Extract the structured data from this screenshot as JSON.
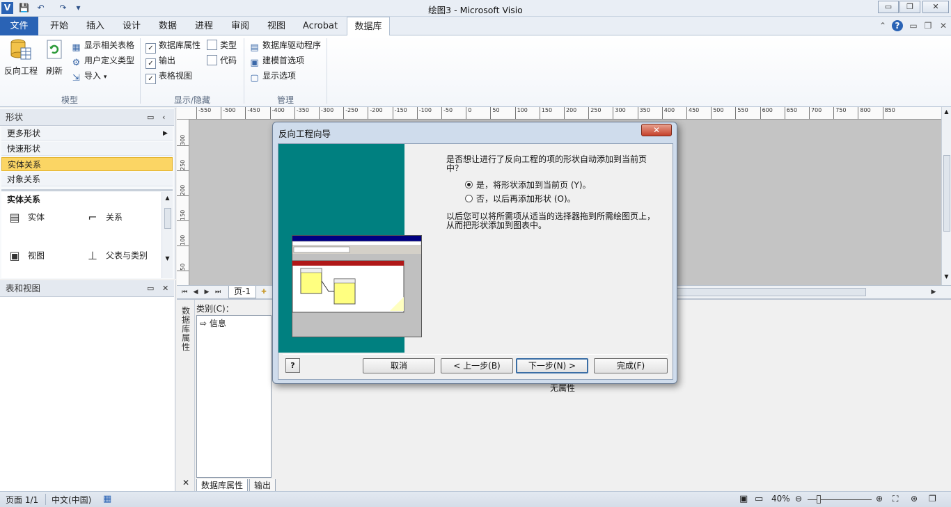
{
  "window": {
    "title": "绘图3  -  Microsoft Visio",
    "minimize": "▭",
    "restore": "❐",
    "close": "✕"
  },
  "ribbon_tabs": [
    "文件",
    "开始",
    "插入",
    "设计",
    "数据",
    "进程",
    "审阅",
    "视图",
    "Acrobat",
    "数据库"
  ],
  "ribbon": {
    "model": {
      "reverse_engineer": "反向工程",
      "refresh": "刷新",
      "show_related_tables": "显示相关表格",
      "user_defined_types": "用户定义类型",
      "import": "导入",
      "group_label": "模型"
    },
    "show_hide": {
      "db_properties": "数据库属性",
      "output": "输出",
      "table_view": "表格视图",
      "types": "类型",
      "code": "代码",
      "group_label": "显示/隐藏"
    },
    "manage": {
      "db_drivers": "数据库驱动程序",
      "modeling_prefs": "建模首选项",
      "display_options": "显示选项",
      "group_label": "管理"
    }
  },
  "shapes_panel": {
    "title": "形状",
    "items": [
      "更多形状",
      "快速形状",
      "实体关系",
      "对象关系"
    ],
    "section_title": "实体关系",
    "stencils": [
      "实体",
      "关系",
      "视图",
      "父表与类别"
    ]
  },
  "tables_panel": {
    "title": "表和视图"
  },
  "ruler_labels": [
    "-550",
    "-500",
    "-450",
    "-400",
    "-350",
    "-300",
    "-250",
    "-200",
    "-150",
    "-100",
    "-50",
    "0",
    "50",
    "100",
    "150",
    "200",
    "250",
    "300",
    "350",
    "400",
    "450",
    "500",
    "550",
    "600",
    "650",
    "700",
    "750",
    "800",
    "850"
  ],
  "vruler_labels": [
    "300",
    "250",
    "200",
    "150",
    "100",
    "50"
  ],
  "page_tab": "页-1",
  "properties": {
    "side_title": "数据库属性",
    "category_label": "类别(C)：",
    "category_item": "信息",
    "no_props": "无属性",
    "bottom_tabs": [
      "数据库属性",
      "输出"
    ]
  },
  "status": {
    "page": "页面 1/1",
    "language": "中文(中国)",
    "zoom": "40%"
  },
  "dialog": {
    "title": "反向工程向导",
    "question": "是否想让进行了反向工程的项的形状自动添加到当前页中？",
    "option_yes": "是，将形状添加到当前页 (Y)。",
    "option_no": "否，以后再添加形状 (O)。",
    "info": "以后您可以将所需项从适当的选择器拖到所需绘图页上，从而把形状添加到图表中。",
    "buttons": {
      "cancel": "取消",
      "back": "< 上一步(B)",
      "next": "下一步(N) >",
      "finish": "完成(F)"
    },
    "close": "✕"
  }
}
